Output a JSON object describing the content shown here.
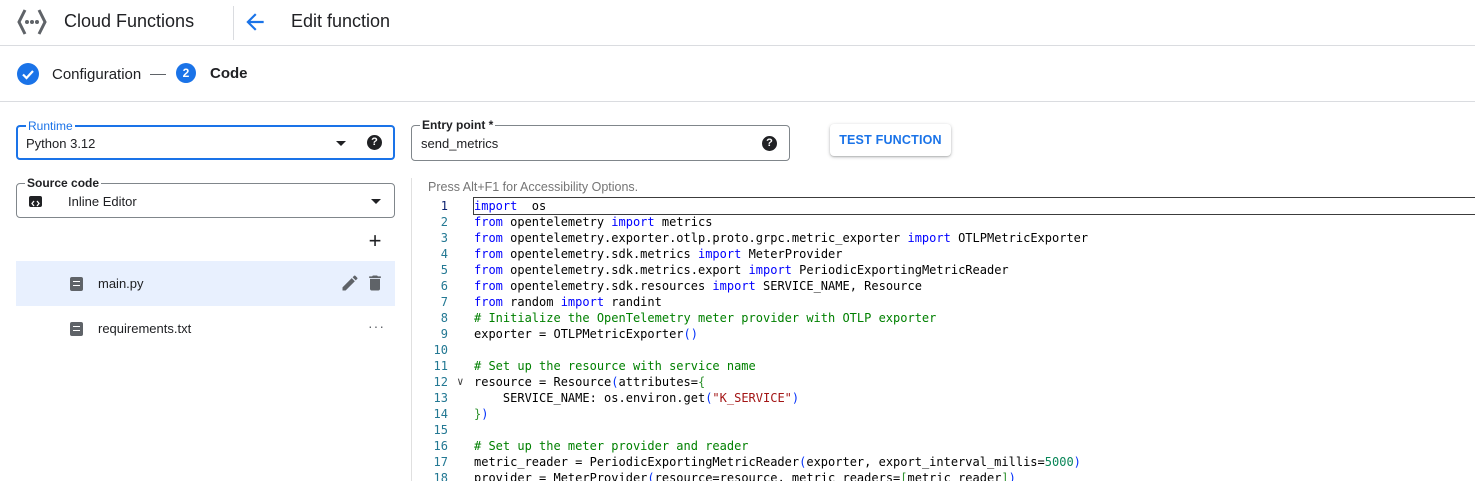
{
  "header": {
    "product_name": "Cloud Functions",
    "page_title": "Edit function",
    "icons": {
      "logo": "cloud-functions-logo",
      "back": "arrow-back-icon"
    }
  },
  "stepper": {
    "steps": [
      {
        "label": "Configuration",
        "state": "completed"
      },
      {
        "number": "2",
        "label": "Code",
        "state": "active"
      }
    ]
  },
  "runtime": {
    "label": "Runtime",
    "value": "Python 3.12"
  },
  "entry_point": {
    "label": "Entry point *",
    "value": "send_metrics"
  },
  "test_button": {
    "label": "TEST FUNCTION"
  },
  "source_code": {
    "label": "Source code",
    "value": "Inline Editor"
  },
  "files": [
    {
      "name": "main.py",
      "selected": true
    },
    {
      "name": "requirements.txt",
      "selected": false
    }
  ],
  "editor": {
    "accessibility_hint": "Press Alt+F1 for Accessibility Options.",
    "lines": [
      {
        "n": "1",
        "tokens": [
          [
            "kw",
            "import"
          ],
          [
            "",
            "  os"
          ]
        ]
      },
      {
        "n": "2",
        "tokens": [
          [
            "kw",
            "from"
          ],
          [
            "",
            " opentelemetry "
          ],
          [
            "kw",
            "import"
          ],
          [
            "",
            " metrics"
          ]
        ]
      },
      {
        "n": "3",
        "tokens": [
          [
            "kw",
            "from"
          ],
          [
            "",
            " opentelemetry.exporter.otlp.proto.grpc.metric_exporter "
          ],
          [
            "kw",
            "import"
          ],
          [
            "",
            " OTLPMetricExporter"
          ]
        ]
      },
      {
        "n": "4",
        "tokens": [
          [
            "kw",
            "from"
          ],
          [
            "",
            " opentelemetry.sdk.metrics "
          ],
          [
            "kw",
            "import"
          ],
          [
            "",
            " MeterProvider"
          ]
        ]
      },
      {
        "n": "5",
        "tokens": [
          [
            "kw",
            "from"
          ],
          [
            "",
            " opentelemetry.sdk.metrics.export "
          ],
          [
            "kw",
            "import"
          ],
          [
            "",
            " PeriodicExportingMetricReader"
          ]
        ]
      },
      {
        "n": "6",
        "tokens": [
          [
            "kw",
            "from"
          ],
          [
            "",
            " opentelemetry.sdk.resources "
          ],
          [
            "kw",
            "import"
          ],
          [
            "",
            " SERVICE_NAME, Resource"
          ]
        ]
      },
      {
        "n": "7",
        "tokens": [
          [
            "kw",
            "from"
          ],
          [
            "",
            " random "
          ],
          [
            "kw",
            "import"
          ],
          [
            "",
            " randint"
          ]
        ]
      },
      {
        "n": "8",
        "tokens": [
          [
            "cm",
            "# Initialize the OpenTelemetry meter provider with OTLP exporter"
          ]
        ]
      },
      {
        "n": "9",
        "tokens": [
          [
            "",
            "exporter = OTLPMetricExporter"
          ],
          [
            "br",
            "()"
          ]
        ]
      },
      {
        "n": "10",
        "tokens": []
      },
      {
        "n": "11",
        "tokens": [
          [
            "cm",
            "# Set up the resource with service name"
          ]
        ]
      },
      {
        "n": "12",
        "tokens": [
          [
            "",
            "resource = Resource"
          ],
          [
            "br",
            "("
          ],
          [
            "",
            "attributes="
          ],
          [
            "br2",
            "{"
          ]
        ]
      },
      {
        "n": "13",
        "tokens": [
          [
            "",
            "    SERVICE_NAME: os.environ.get"
          ],
          [
            "br",
            "("
          ],
          [
            "st",
            "\"K_SERVICE\""
          ],
          [
            "br",
            ")"
          ]
        ]
      },
      {
        "n": "14",
        "tokens": [
          [
            "br2",
            "}"
          ],
          [
            "br",
            ")"
          ]
        ]
      },
      {
        "n": "15",
        "tokens": []
      },
      {
        "n": "16",
        "tokens": [
          [
            "cm",
            "# Set up the meter provider and reader"
          ]
        ]
      },
      {
        "n": "17",
        "tokens": [
          [
            "",
            "metric_reader = PeriodicExportingMetricReader"
          ],
          [
            "br",
            "("
          ],
          [
            "",
            "exporter, export_interval_millis="
          ],
          [
            "nm",
            "5000"
          ],
          [
            "br",
            ")"
          ]
        ]
      },
      {
        "n": "18",
        "tokens": [
          [
            "",
            "provider = MeterProvider"
          ],
          [
            "br",
            "("
          ],
          [
            "",
            "resource=resource, metric_readers="
          ],
          [
            "br2",
            "["
          ],
          [
            "",
            "metric_reader"
          ],
          [
            "br2",
            "]"
          ],
          [
            "br",
            ")"
          ]
        ]
      }
    ]
  }
}
